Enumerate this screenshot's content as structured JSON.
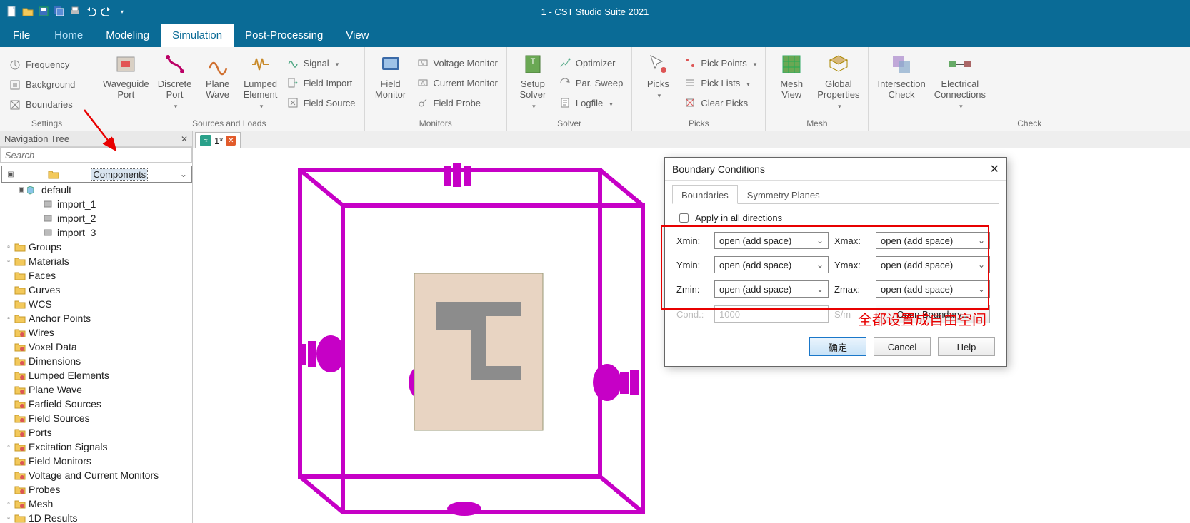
{
  "app": {
    "title": "1 - CST Studio Suite 2021"
  },
  "menu": {
    "file": "File",
    "home": "Home",
    "modeling": "Modeling",
    "simulation": "Simulation",
    "post": "Post-Processing",
    "view": "View"
  },
  "ribbon": {
    "settings": {
      "label": "Settings",
      "frequency": "Frequency",
      "background": "Background",
      "boundaries": "Boundaries"
    },
    "sources": {
      "label": "Sources and Loads",
      "waveguide": "Waveguide\nPort",
      "discrete": "Discrete\nPort",
      "plane": "Plane\nWave",
      "lumped": "Lumped\nElement",
      "signal": "Signal",
      "fieldimport": "Field Import",
      "fieldsource": "Field Source"
    },
    "monitors": {
      "label": "Monitors",
      "field": "Field\nMonitor",
      "voltage": "Voltage Monitor",
      "current": "Current Monitor",
      "probe": "Field Probe"
    },
    "solver": {
      "label": "Solver",
      "setup": "Setup\nSolver",
      "optimizer": "Optimizer",
      "parsweep": "Par. Sweep",
      "logfile": "Logfile"
    },
    "picks": {
      "label": "Picks",
      "picks": "Picks",
      "pickpoints": "Pick Points",
      "picklists": "Pick Lists",
      "clearpicks": "Clear Picks"
    },
    "mesh": {
      "label": "Mesh",
      "meshview": "Mesh\nView",
      "global": "Global\nProperties"
    },
    "check": {
      "label": "Check",
      "intersection": "Intersection\nCheck",
      "electrical": "Electrical\nConnections"
    }
  },
  "nav": {
    "title": "Navigation Tree",
    "search_placeholder": "Search"
  },
  "tree": {
    "components": "Components",
    "default": "default",
    "imports": [
      "import_1",
      "import_2",
      "import_3"
    ],
    "nodes": [
      "Groups",
      "Materials",
      "Faces",
      "Curves",
      "WCS",
      "Anchor Points",
      "Wires",
      "Voxel Data",
      "Dimensions",
      "Lumped Elements",
      "Plane Wave",
      "Farfield Sources",
      "Field Sources",
      "Ports",
      "Excitation Signals",
      "Field Monitors",
      "Voltage and Current Monitors",
      "Probes",
      "Mesh",
      "1D Results"
    ]
  },
  "doctab": {
    "name": "1*"
  },
  "dialog": {
    "title": "Boundary Conditions",
    "tabs": {
      "boundaries": "Boundaries",
      "symmetry": "Symmetry Planes"
    },
    "apply_all": "Apply in all directions",
    "labels": {
      "xmin": "Xmin:",
      "xmax": "Xmax:",
      "ymin": "Ymin:",
      "ymax": "Ymax:",
      "zmin": "Zmin:",
      "zmax": "Zmax:",
      "cond": "Cond.:",
      "sm": "S/m"
    },
    "value": "open (add space)",
    "cond_value": "1000",
    "openbtn": "Open Boundary...",
    "ok": "确定",
    "cancel": "Cancel",
    "help": "Help"
  },
  "annotation": {
    "note": "全都设置成自由空间"
  }
}
